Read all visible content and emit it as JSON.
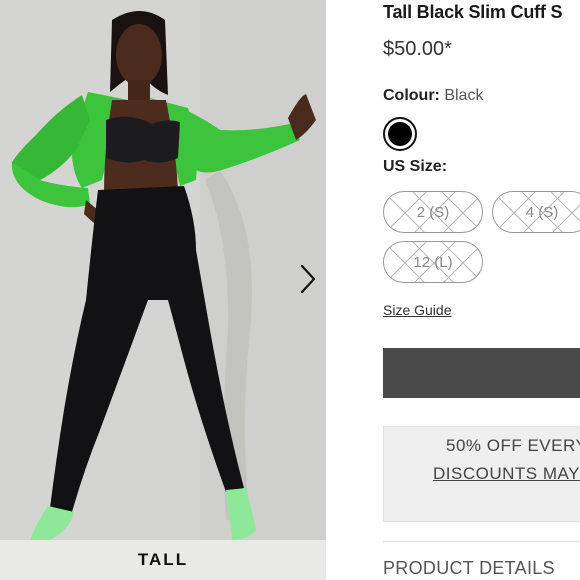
{
  "gallery": {
    "badge": "TALL",
    "next_icon": "chevron-right-icon"
  },
  "product": {
    "title": "Tall Black Slim Cuff S",
    "price": "$50.00*",
    "colour_label": "Colour:",
    "colour_value": "Black",
    "swatch_color": "#000000",
    "size_label": "US Size:",
    "sizes": [
      {
        "label": "2 (S)",
        "available": false
      },
      {
        "label": "4 (S)",
        "available": false
      },
      {
        "label": "12 (L)",
        "available": false
      }
    ],
    "size_guide": "Size Guide"
  },
  "promo": {
    "line1": "50% OFF EVERY",
    "line2": "DISCOUNTS MAY N"
  },
  "details": {
    "label": "PRODUCT DETAILS"
  },
  "colors": {
    "add_button": "#4a4a4a",
    "jacket": "#3cc43c",
    "shoes": "#8ee89a"
  }
}
